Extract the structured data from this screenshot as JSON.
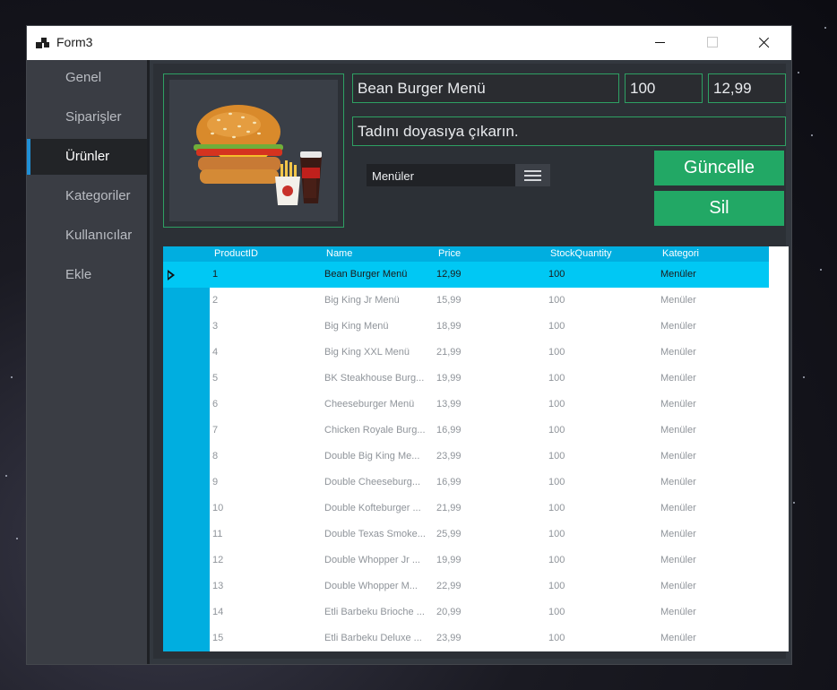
{
  "window": {
    "title": "Form3"
  },
  "sidebar": {
    "items": [
      {
        "label": "Genel",
        "name": "sidebar-item-genel"
      },
      {
        "label": "Siparişler",
        "name": "sidebar-item-siparisler"
      },
      {
        "label": "Ürünler",
        "name": "sidebar-item-urunler",
        "active": true
      },
      {
        "label": "Kategoriler",
        "name": "sidebar-item-kategoriler"
      },
      {
        "label": "Kullanıcılar",
        "name": "sidebar-item-kullanicilar"
      },
      {
        "label": "Ekle",
        "name": "sidebar-item-ekle"
      }
    ]
  },
  "form": {
    "name_value": "Bean Burger Menü",
    "stock_value": "100",
    "price_value": "12,99",
    "description_value": "Tadını doyasıya çıkarın.",
    "category_selected": "Menüler",
    "update_label": "Güncelle",
    "delete_label": "Sil"
  },
  "colors": {
    "accent_green": "#22a865",
    "grid_header": "#00aee0",
    "selected_row": "#00c8f4",
    "active_nav_indicator": "#1f8fd6"
  },
  "table": {
    "headers": [
      "ProductID",
      "Name",
      "Price",
      "StockQuantity",
      "Kategori"
    ],
    "rows": [
      [
        "1",
        "Bean Burger Menü",
        "12,99",
        "100",
        "Menüler"
      ],
      [
        "2",
        "Big King Jr Menü",
        "15,99",
        "100",
        "Menüler"
      ],
      [
        "3",
        "Big King Menü",
        "18,99",
        "100",
        "Menüler"
      ],
      [
        "4",
        "Big King XXL Menü",
        "21,99",
        "100",
        "Menüler"
      ],
      [
        "5",
        "BK Steakhouse Burg...",
        "19,99",
        "100",
        "Menüler"
      ],
      [
        "6",
        "Cheeseburger Menü",
        "13,99",
        "100",
        "Menüler"
      ],
      [
        "7",
        "Chicken Royale Burg...",
        "16,99",
        "100",
        "Menüler"
      ],
      [
        "8",
        "Double Big King Me...",
        "23,99",
        "100",
        "Menüler"
      ],
      [
        "9",
        "Double Cheeseburg...",
        "16,99",
        "100",
        "Menüler"
      ],
      [
        "10",
        "Double Kofteburger ...",
        "21,99",
        "100",
        "Menüler"
      ],
      [
        "11",
        "Double Texas Smoke...",
        "25,99",
        "100",
        "Menüler"
      ],
      [
        "12",
        "Double Whopper Jr ...",
        "19,99",
        "100",
        "Menüler"
      ],
      [
        "13",
        "Double Whopper M...",
        "22,99",
        "100",
        "Menüler"
      ],
      [
        "14",
        "Etli Barbeku Brioche ...",
        "20,99",
        "100",
        "Menüler"
      ],
      [
        "15",
        "Etli Barbeku Deluxe ...",
        "23,99",
        "100",
        "Menüler"
      ]
    ],
    "selected_index": 0
  }
}
